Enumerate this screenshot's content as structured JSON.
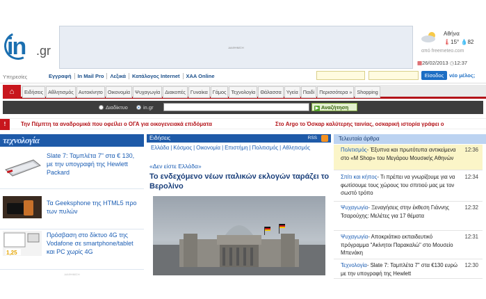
{
  "logo": {
    "main": "in",
    "suffix": ".gr"
  },
  "ad_top": {
    "label": "ΔΙΑΦΗΜΙΣΗ"
  },
  "weather": {
    "city": "Αθήνα",
    "temp": "15°",
    "humidity": "82",
    "source": "από freemeteo.com"
  },
  "datetime": {
    "date": "26/02/2013",
    "time": "12:37"
  },
  "util": {
    "label": "Υπηρεσίες",
    "links": [
      "Εγγραφή",
      "In Mail Pro",
      "Λεξικά",
      "Κατάλογος Internet",
      "XAA Online"
    ],
    "login": "Είσοδος",
    "new_member": "νέο μέλος;"
  },
  "nav": {
    "tabs": [
      "Ειδήσεις",
      "Αθλητισμός",
      "Αυτοκίνητο",
      "Οικονομία",
      "Ψυχαγωγία",
      "Διακοπές",
      "Γυναίκα",
      "Γάμος",
      "Τεχνολογία",
      "Θάλασσα",
      "Υγεία",
      "Παιδί",
      "Περισσότερα »",
      "Shopping"
    ]
  },
  "search": {
    "opt1": "Διαδίκτυο",
    "opt2": "in.gr",
    "button": "Αναζήτηση"
  },
  "ticker": [
    "Την Πέμπτη τα αναδρομικά που οφείλει ο ΟΓΑ για οικογενειακά επιδόματα",
    "Στο Argo το Όσκαρ καλύτερης ταινίας, οσκαρική ιστορία γράφει ο"
  ],
  "tech": {
    "title": "τεχνολογία",
    "items": [
      "Slate 7: Ταμπλέτα 7\" στα € 130, με την υπογραφή της Hewlett Packard",
      "Τα Geeksphone της HTML5 προ των πυλών",
      "Πρόσβαση στο δίκτυο 4G της Vodafone σε smartphone/tablet και PC χωρίς 4G"
    ],
    "ad": "ΔΙΑΦΗΜΙΣΗ"
  },
  "news": {
    "header": "Ειδήσεις",
    "rss": "RSS",
    "subnav": [
      "Ελλάδα",
      "Κόσμος",
      "Οικονομία",
      "Επιστήμη",
      "Πολιτισμός",
      "Αθλητισμός"
    ],
    "kicker": "«Δεν είστε Ελλάδα»",
    "headline": "Το ενδεχόμενο νέων ιταλικών εκλογών ταράζει το Βερολίνο"
  },
  "latest": {
    "header": "Τελευταία άρθρα",
    "items": [
      {
        "cat": "Πολιτισμός",
        "text": "Έξυπνα και πρωτότυπα αντικείμενα στο «M Shop» του Μεγάρου Μουσικής Αθηνών",
        "time": "12:36"
      },
      {
        "cat": "Σπίτι και κήπος",
        "text": "Τι πρέπει να γνωρίζουμε για να φωτίσουμε τους χώρους του σπιτιού μας με τον σωστό τρόπο",
        "time": "12:34"
      },
      {
        "cat": "Ψυχαγωγία",
        "text": "Ξεναγήσεις στην έκθεση Γιάννης Τσαρούχης: Μελέτες για 17 θέματα",
        "time": "12:32"
      },
      {
        "cat": "Ψυχαγωγία",
        "text": "Αποκριάτικο εκπαιδευτικό πρόγραμμα \"Ακίνητοι Παρακαλώ\" στο Μουσείο Μπενάκη",
        "time": "12:31"
      },
      {
        "cat": "Τεχνολογία",
        "text": "Slate 7: Ταμπλέτα 7\" στα €130 ευρώ με την υπογραφή της Hewlett",
        "time": "12:30"
      }
    ]
  }
}
